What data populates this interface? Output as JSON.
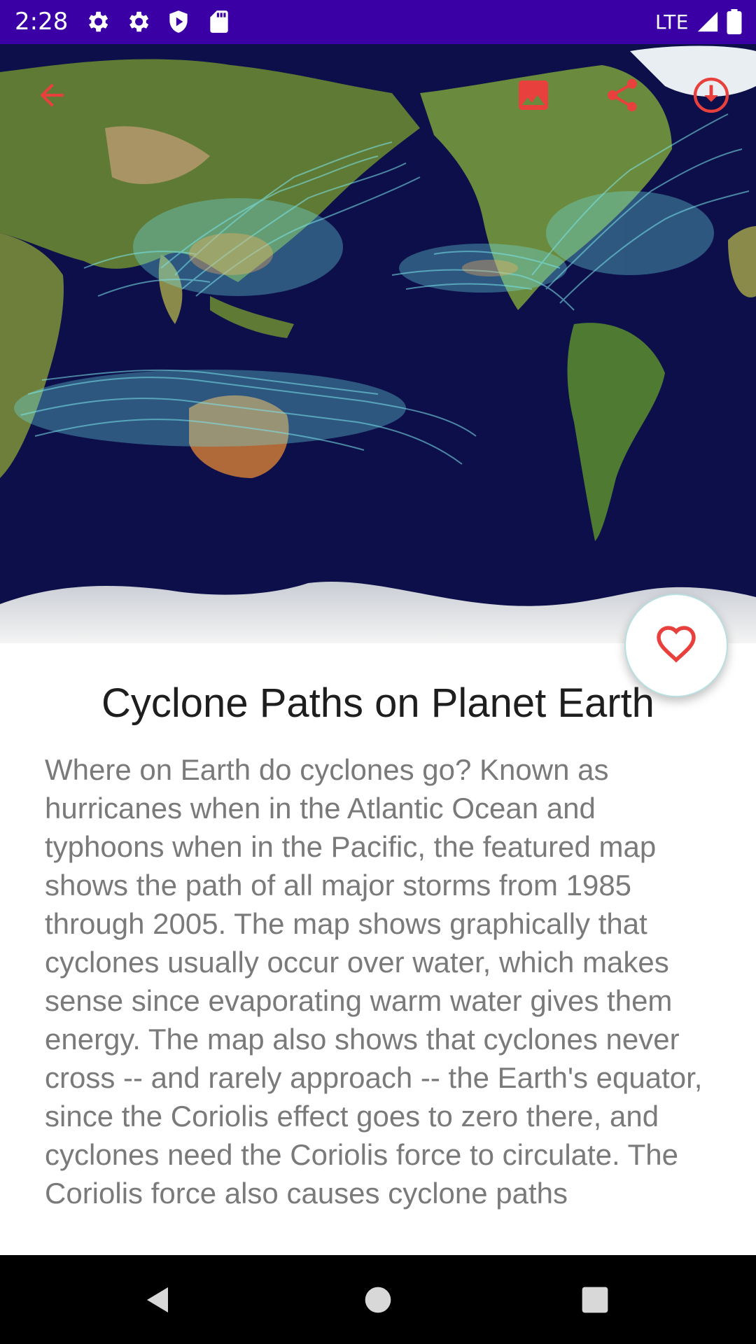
{
  "status_bar": {
    "time": "2:28",
    "network": "LTE",
    "icons": [
      "settings-icon",
      "settings-icon",
      "shield-icon",
      "sd-card-icon",
      "signal-icon",
      "battery-icon"
    ]
  },
  "toolbar": {
    "back": "arrow-back-icon",
    "set_wallpaper": "image-icon",
    "share": "share-icon",
    "download": "download-icon",
    "accent_color": "#e8413d"
  },
  "favorite": {
    "icon": "heart-outline-icon"
  },
  "article": {
    "title": "Cyclone Paths on Planet Earth",
    "description": "Where on Earth do cyclones go? Known as hurricanes when in the Atlantic Ocean and typhoons when in the Pacific, the featured map shows the path of all major storms from 1985 through 2005.  The map shows graphically that cyclones usually occur over water, which makes sense since evaporating warm water gives them energy. The map also shows that cyclones never cross -- and rarely approach -- the Earth's equator, since the Coriolis effect goes to zero there, and cyclones need the Coriolis force to circulate. The Coriolis force also causes cyclone paths"
  },
  "nav_bar": {
    "back": "nav-back-icon",
    "home": "nav-home-icon",
    "recents": "nav-recents-icon"
  }
}
